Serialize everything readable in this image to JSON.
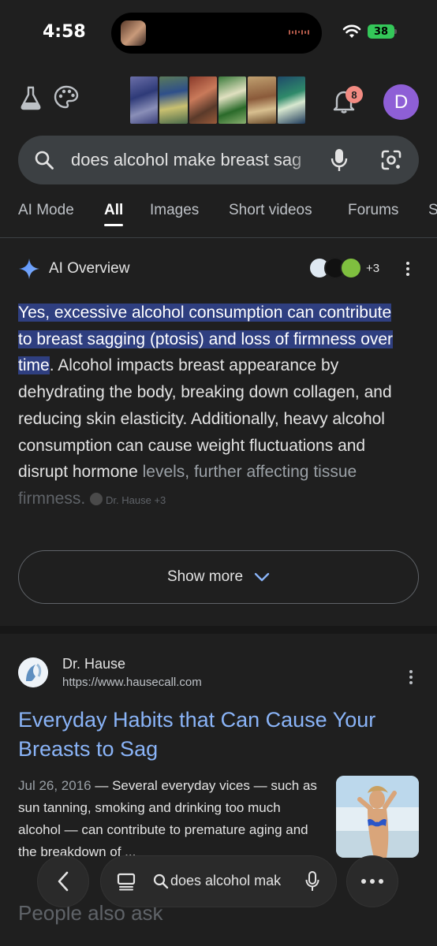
{
  "status_bar": {
    "time": "4:58",
    "battery": "38"
  },
  "header": {
    "notification_count": "8",
    "avatar_letter": "D"
  },
  "search": {
    "query": "does alcohol make breast sag"
  },
  "tabs": [
    {
      "label": "AI Mode"
    },
    {
      "label": "All"
    },
    {
      "label": "Images"
    },
    {
      "label": "Short videos"
    },
    {
      "label": "Forums"
    },
    {
      "label": "S"
    }
  ],
  "active_tab": "All",
  "ai_overview": {
    "title": "AI Overview",
    "source_count": "+3",
    "highlight": "Yes, excessive alcohol consumption can contribute to breast sagging (ptosis) and loss of firmness over time",
    "body": ". Alcohol impacts breast appearance by dehydrating the body, breaking down collagen, and reducing skin elasticity. Additionally, heavy alcohol consumption can cause weight fluctuations and disrupt hormone",
    "faded_1": "levels, further affecting tissue",
    "faded_2": "firmness.",
    "inline_source": "Dr. Hause +3",
    "show_more": "Show more"
  },
  "result": {
    "site": "Dr. Hause",
    "url": "https://www.hausecall.com",
    "title": "Everyday Habits that Can Cause Your Breasts to Sag",
    "date": "Jul 26, 2016",
    "snippet": " — Several everyday vices — such as sun tanning, smoking and drinking too much alcohol — can contribute to premature aging and the breakdown of ..."
  },
  "people_also_ask": "People also ask",
  "bottom_bar": {
    "query": "does alcohol mak"
  },
  "colors": {
    "background": "#1f1f1f",
    "link": "#8ab4f8",
    "highlight": "#2f3f80",
    "avatar": "#8e5fd6",
    "badge": "#f28b82"
  }
}
